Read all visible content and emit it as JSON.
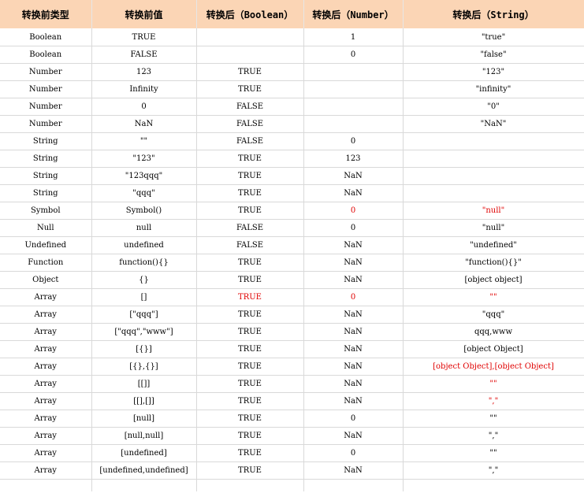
{
  "headers": [
    "转换前类型",
    "转换前值",
    "转换后（Boolean）",
    "转换后（Number）",
    "转换后（String）"
  ],
  "rows": [
    {
      "type": "Boolean",
      "value": "TRUE",
      "bool": "",
      "num": "1",
      "str": "\"true\"",
      "red": []
    },
    {
      "type": "Boolean",
      "value": "FALSE",
      "bool": "",
      "num": "0",
      "str": "\"false\"",
      "red": []
    },
    {
      "type": "Number",
      "value": "123",
      "bool": "TRUE",
      "num": "",
      "str": "\"123\"",
      "red": []
    },
    {
      "type": "Number",
      "value": "Infinity",
      "bool": "TRUE",
      "num": "",
      "str": "\"infinity\"",
      "red": []
    },
    {
      "type": "Number",
      "value": "0",
      "bool": "FALSE",
      "num": "",
      "str": "\"0\"",
      "red": []
    },
    {
      "type": "Number",
      "value": "NaN",
      "bool": "FALSE",
      "num": "",
      "str": "\"NaN\"",
      "red": []
    },
    {
      "type": "String",
      "value": "\"\"",
      "bool": "FALSE",
      "num": "0",
      "str": "",
      "red": []
    },
    {
      "type": "String",
      "value": "\"123\"",
      "bool": "TRUE",
      "num": "123",
      "str": "",
      "red": []
    },
    {
      "type": "String",
      "value": "\"123qqq\"",
      "bool": "TRUE",
      "num": "NaN",
      "str": "",
      "red": []
    },
    {
      "type": "String",
      "value": "\"qqq\"",
      "bool": "TRUE",
      "num": "NaN",
      "str": "",
      "red": []
    },
    {
      "type": "Symbol",
      "value": "Symbol()",
      "bool": "TRUE",
      "num": "0",
      "str": "\"null\"",
      "red": [
        "num",
        "str"
      ]
    },
    {
      "type": "Null",
      "value": "null",
      "bool": "FALSE",
      "num": "0",
      "str": "\"null\"",
      "red": []
    },
    {
      "type": "Undefined",
      "value": "undefined",
      "bool": "FALSE",
      "num": "NaN",
      "str": "\"undefined\"",
      "red": []
    },
    {
      "type": "Function",
      "value": "function(){}",
      "bool": "TRUE",
      "num": "NaN",
      "str": "\"function(){}\"",
      "red": []
    },
    {
      "type": "Object",
      "value": "{}",
      "bool": "TRUE",
      "num": "NaN",
      "str": "[object object]",
      "red": []
    },
    {
      "type": "Array",
      "value": "[]",
      "bool": "TRUE",
      "num": "0",
      "str": "\"\"",
      "red": [
        "bool",
        "num",
        "str"
      ]
    },
    {
      "type": "Array",
      "value": "[\"qqq\"]",
      "bool": "TRUE",
      "num": "NaN",
      "str": "\"qqq\"",
      "red": []
    },
    {
      "type": "Array",
      "value": "[\"qqq\",\"www\"]",
      "bool": "TRUE",
      "num": "NaN",
      "str": "qqq,www",
      "red": []
    },
    {
      "type": "Array",
      "value": "[{}]",
      "bool": "TRUE",
      "num": "NaN",
      "str": "[object Object]",
      "red": []
    },
    {
      "type": "Array",
      "value": "[{},{}]",
      "bool": "TRUE",
      "num": "NaN",
      "str": "[object Object],[object Object]",
      "red": [
        "str"
      ]
    },
    {
      "type": "Array",
      "value": "[[]]",
      "bool": "TRUE",
      "num": "NaN",
      "str": "\"\"",
      "red": [
        "str"
      ]
    },
    {
      "type": "Array",
      "value": "[[],[]]",
      "bool": "TRUE",
      "num": "NaN",
      "str": "\",\"",
      "red": [
        "str"
      ]
    },
    {
      "type": "Array",
      "value": "[null]",
      "bool": "TRUE",
      "num": "0",
      "str": "\"\"",
      "red": []
    },
    {
      "type": "Array",
      "value": "[null,null]",
      "bool": "TRUE",
      "num": "NaN",
      "str": "\",\"",
      "red": []
    },
    {
      "type": "Array",
      "value": "[undefined]",
      "bool": "TRUE",
      "num": "0",
      "str": "\"\"",
      "red": []
    },
    {
      "type": "Array",
      "value": "[undefined,undefined]",
      "bool": "TRUE",
      "num": "NaN",
      "str": "\",\"",
      "red": []
    }
  ],
  "colors": {
    "header_bg": "#fbd5b5",
    "highlight": "#e00000"
  }
}
